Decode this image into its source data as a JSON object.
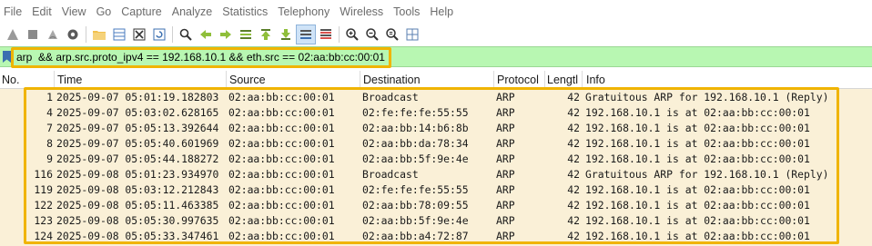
{
  "menu": [
    "File",
    "Edit",
    "View",
    "Go",
    "Capture",
    "Analyze",
    "Statistics",
    "Telephony",
    "Wireless",
    "Tools",
    "Help"
  ],
  "toolbar": {
    "icons": [
      "shark-fin-start-icon",
      "stop-square-icon",
      "restart-shark-icon",
      "options-gear-icon",
      "open-folder-icon",
      "file-table-icon",
      "close-file-icon",
      "reload-icon",
      "find-icon",
      "go-back-icon",
      "go-forward-icon",
      "go-to-packet-icon",
      "go-first-icon",
      "go-last-icon",
      "autoscroll-icon",
      "colorize-icon",
      "zoom-in-icon",
      "zoom-out-icon",
      "zoom-normal-icon",
      "resize-columns-icon"
    ]
  },
  "filter": {
    "value": "arp  && arp.src.proto_ipv4 == 192.168.10.1 && eth.src == 02:aa:bb:cc:00:01"
  },
  "columns": {
    "no": "No.",
    "time": "Time",
    "source": "Source",
    "destination": "Destination",
    "protocol": "Protocol",
    "length": "Lengtl",
    "info": "Info"
  },
  "rows": [
    {
      "no": "1",
      "time": "2025-09-07 05:01:19.182803",
      "source": "02:aa:bb:cc:00:01",
      "destination": "Broadcast",
      "protocol": "ARP",
      "length": "42",
      "info": "Gratuitous ARP for 192.168.10.1 (Reply)"
    },
    {
      "no": "4",
      "time": "2025-09-07 05:03:02.628165",
      "source": "02:aa:bb:cc:00:01",
      "destination": "02:fe:fe:fe:55:55",
      "protocol": "ARP",
      "length": "42",
      "info": "192.168.10.1 is at 02:aa:bb:cc:00:01"
    },
    {
      "no": "7",
      "time": "2025-09-07 05:05:13.392644",
      "source": "02:aa:bb:cc:00:01",
      "destination": "02:aa:bb:14:b6:8b",
      "protocol": "ARP",
      "length": "42",
      "info": "192.168.10.1 is at 02:aa:bb:cc:00:01"
    },
    {
      "no": "8",
      "time": "2025-09-07 05:05:40.601969",
      "source": "02:aa:bb:cc:00:01",
      "destination": "02:aa:bb:da:78:34",
      "protocol": "ARP",
      "length": "42",
      "info": "192.168.10.1 is at 02:aa:bb:cc:00:01"
    },
    {
      "no": "9",
      "time": "2025-09-07 05:05:44.188272",
      "source": "02:aa:bb:cc:00:01",
      "destination": "02:aa:bb:5f:9e:4e",
      "protocol": "ARP",
      "length": "42",
      "info": "192.168.10.1 is at 02:aa:bb:cc:00:01"
    },
    {
      "no": "116",
      "time": "2025-09-08 05:01:23.934970",
      "source": "02:aa:bb:cc:00:01",
      "destination": "Broadcast",
      "protocol": "ARP",
      "length": "42",
      "info": "Gratuitous ARP for 192.168.10.1 (Reply)"
    },
    {
      "no": "119",
      "time": "2025-09-08 05:03:12.212843",
      "source": "02:aa:bb:cc:00:01",
      "destination": "02:fe:fe:fe:55:55",
      "protocol": "ARP",
      "length": "42",
      "info": "192.168.10.1 is at 02:aa:bb:cc:00:01"
    },
    {
      "no": "122",
      "time": "2025-09-08 05:05:11.463385",
      "source": "02:aa:bb:cc:00:01",
      "destination": "02:aa:bb:78:09:55",
      "protocol": "ARP",
      "length": "42",
      "info": "192.168.10.1 is at 02:aa:bb:cc:00:01"
    },
    {
      "no": "123",
      "time": "2025-09-08 05:05:30.997635",
      "source": "02:aa:bb:cc:00:01",
      "destination": "02:aa:bb:5f:9e:4e",
      "protocol": "ARP",
      "length": "42",
      "info": "192.168.10.1 is at 02:aa:bb:cc:00:01"
    },
    {
      "no": "124",
      "time": "2025-09-08 05:05:33.347461",
      "source": "02:aa:bb:cc:00:01",
      "destination": "02:aa:bb:a4:72:87",
      "protocol": "ARP",
      "length": "42",
      "info": "192.168.10.1 is at 02:aa:bb:cc:00:01"
    }
  ],
  "colors": {
    "filter_valid_bg": "#b8f7b2",
    "row_bg": "#faf0d7",
    "highlight": "#f0b400",
    "menu_text": "#6b6b6b"
  }
}
